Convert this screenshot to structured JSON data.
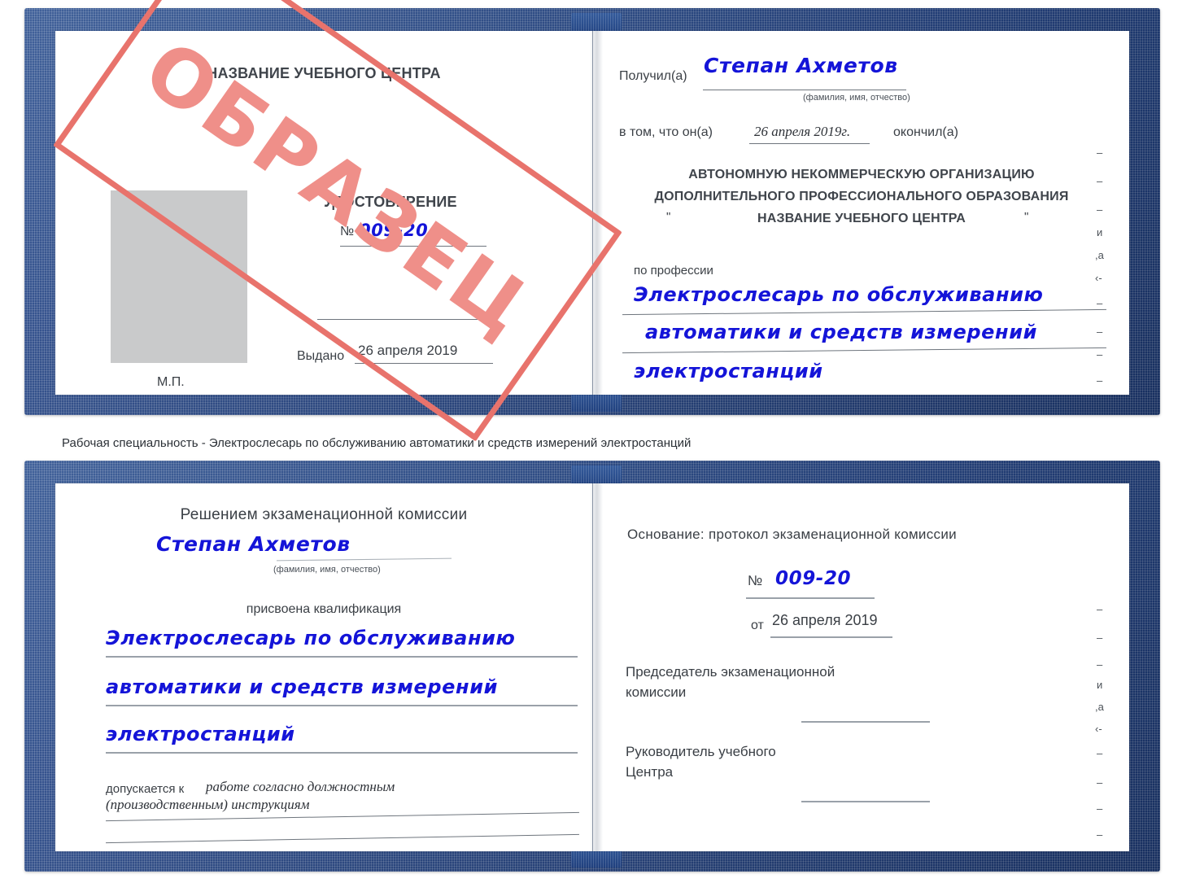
{
  "caption": {
    "text": "Рабочая специальность - Электрослесарь по обслуживанию автоматики и средств измерений электростанций"
  },
  "certificate_top": {
    "left_page": {
      "org_title": "НАЗВАНИЕ УЧЕБНОГО ЦЕНТРА",
      "doc_type": "УДОСТОВЕРЕНИЕ",
      "number_label": "№",
      "number_value": "009-20",
      "issued_label": "Выдано",
      "issued_date": "26 апреля 2019",
      "seal_label": "М.П."
    },
    "right_page": {
      "received_label": "Получил(а)",
      "received_name": "Степан Ахметов",
      "name_hint": "(фамилия, имя, отчество)",
      "in_that_label": "в том, что он(а)",
      "completion_date": "26 апреля 2019г.",
      "finished_label": "окончил(а)",
      "org_line1": "АВТОНОМНУЮ НЕКОММЕРЧЕСКУЮ ОРГАНИЗАЦИЮ",
      "org_line2": "ДОПОЛНИТЕЛЬНОГО ПРОФЕССИОНАЛЬНОГО ОБРАЗОВАНИЯ",
      "org_quote_open": "\"",
      "org_line3": "НАЗВАНИЕ УЧЕБНОГО ЦЕНТРА",
      "org_quote_close": "\"",
      "profession_label": "по профессии",
      "profession_line1": "Электрослесарь по обслуживанию",
      "profession_line2": "автоматики и средств измерений",
      "profession_line3": "электростанций"
    },
    "stamp": {
      "text": "ОБРАЗЕЦ",
      "color": "#e8736c",
      "fill_color": "#ef8f89"
    }
  },
  "certificate_bottom": {
    "left_page": {
      "decision_title": "Решением экзаменационной комиссии",
      "name": "Степан Ахметов",
      "name_hint": "(фамилия, имя, отчество)",
      "qualification_label": "присвоена квалификация",
      "qualification_line1": "Электрослесарь по обслуживанию",
      "qualification_line2": "автоматики и средств измерений",
      "qualification_line3": "электростанций",
      "admitted_label": "допускается к",
      "admitted_value1": "работе согласно должностным",
      "admitted_value2": "(производственным) инструкциям"
    },
    "right_page": {
      "basis_label": "Основание: протокол экзаменационной комиссии",
      "number_label": "№",
      "number_value": "009-20",
      "date_label": "от",
      "date_value": "26 апреля 2019",
      "chairman_line1": "Председатель экзаменационной",
      "chairman_line2": "комиссии",
      "head_line1": "Руководитель учебного",
      "head_line2": "Центра"
    }
  },
  "edge_artifacts": {
    "top": [
      "–",
      "–",
      "–",
      "и",
      ",а",
      "‹-",
      "–",
      "–",
      "–",
      "–"
    ],
    "bottom": [
      "–",
      "–",
      "–",
      "и",
      ",а",
      "‹-",
      "–",
      "–",
      "–",
      "–"
    ]
  },
  "colors": {
    "cover_blue": "#23428a",
    "handwriting_blue": "#1414d8",
    "stamp_red": "#e8736c",
    "photo_grey": "#c9cacb",
    "rule_grey": "#9aa1a9"
  }
}
